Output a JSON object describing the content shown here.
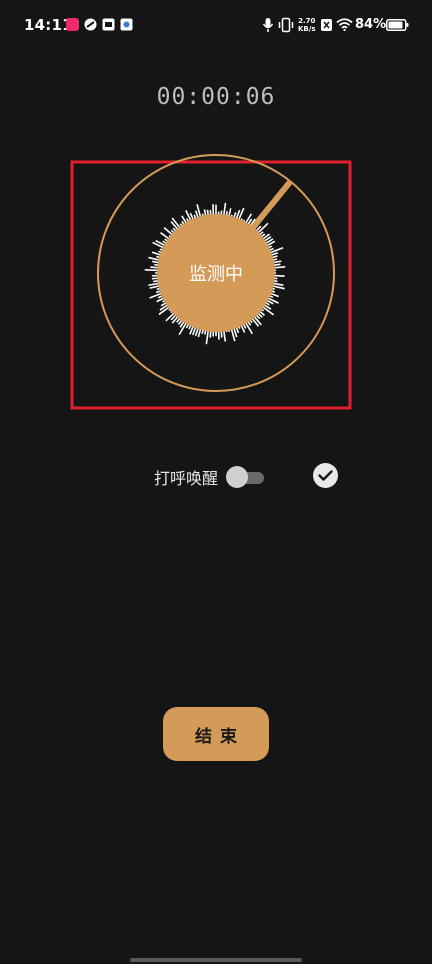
{
  "status_bar": {
    "time": "14:11",
    "net_speed_value": "2.70",
    "net_speed_unit": "KB/s",
    "battery": "84%",
    "icons": [
      "app-notification-icon",
      "app-notification-icon",
      "app-notification-icon",
      "app-notification-icon",
      "microphone-icon",
      "vibrate-icon",
      "data-off-icon",
      "wifi-icon",
      "battery-icon"
    ]
  },
  "timer": "00:00:06",
  "detector": {
    "label": "监测中",
    "accent_color": "#d49a57",
    "highlight_color": "#e0202a"
  },
  "snore_wake": {
    "label": "打呼唤醒",
    "enabled": false
  },
  "end_button": {
    "label": "结束"
  }
}
